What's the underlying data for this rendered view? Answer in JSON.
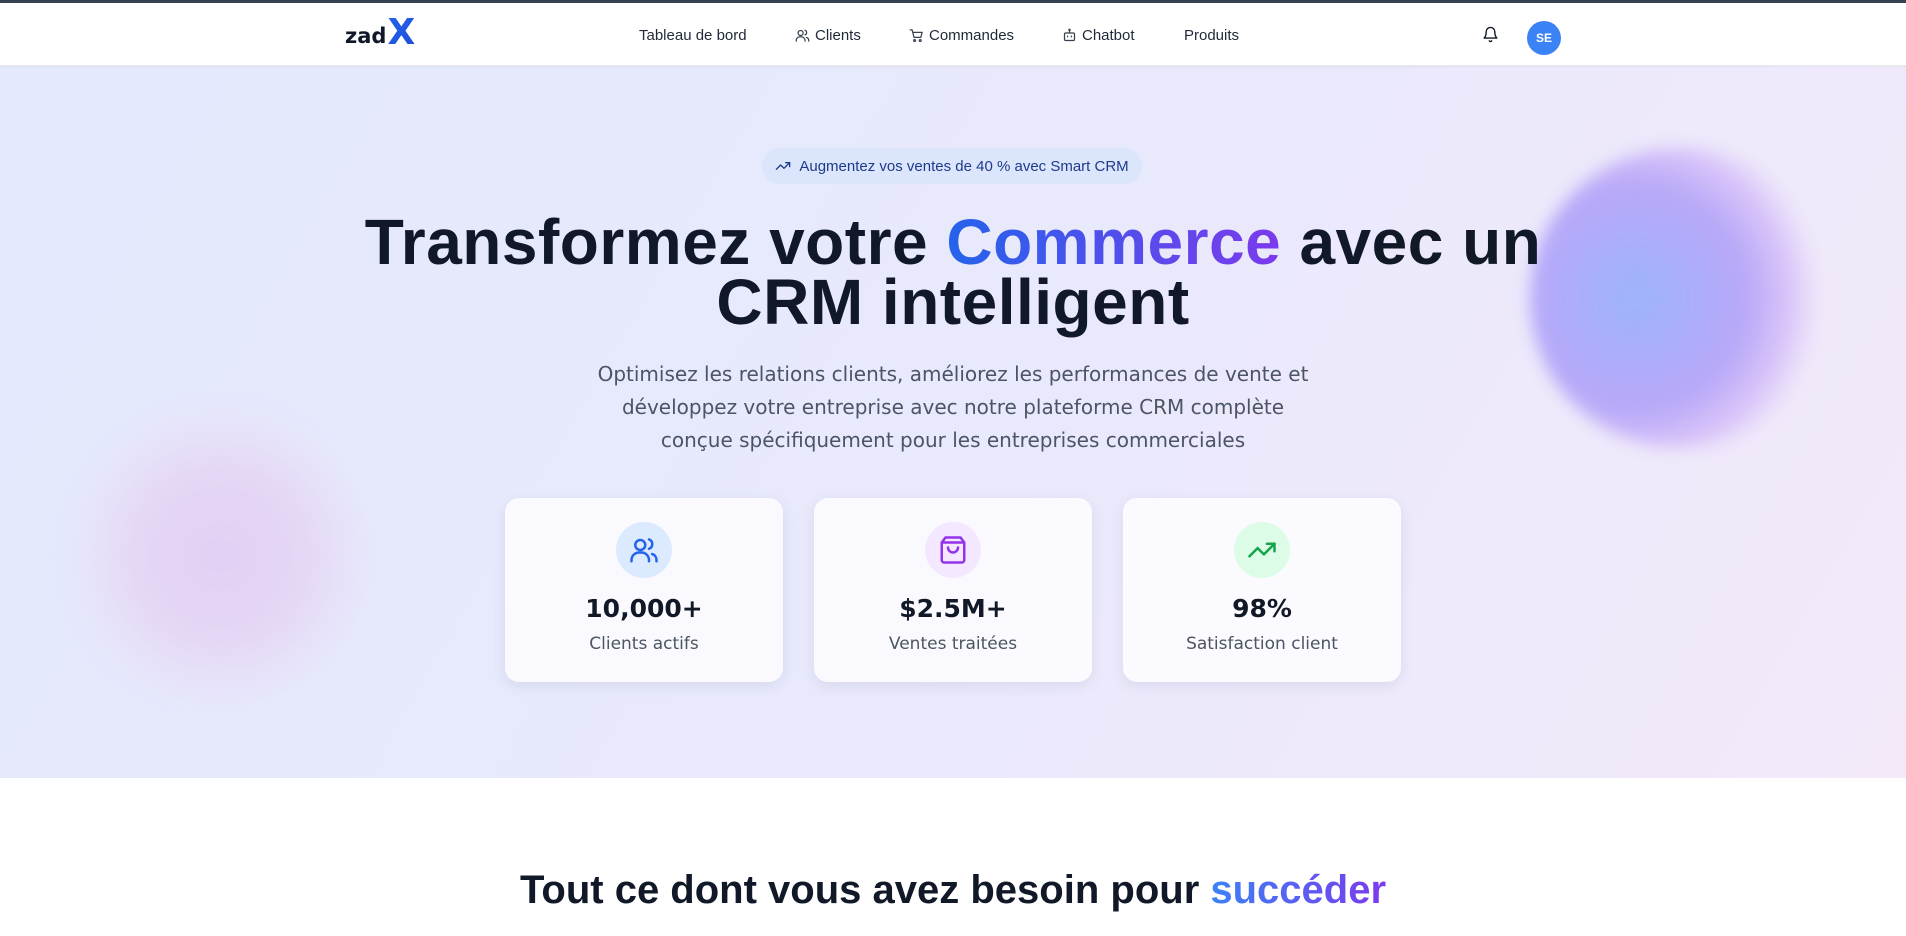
{
  "brand": {
    "text": "zad",
    "mark": "X"
  },
  "nav": {
    "items": [
      {
        "label": "Tableau de bord",
        "icon": ""
      },
      {
        "label": "Clients",
        "icon": "users-icon"
      },
      {
        "label": "Commandes",
        "icon": "cart-icon"
      },
      {
        "label": "Chatbot",
        "icon": "bot-icon"
      },
      {
        "label": "Produits",
        "icon": ""
      }
    ],
    "notifications_icon": "bell-icon",
    "avatar_initials": "SE"
  },
  "hero": {
    "badge": "Augmentez vos ventes de 40 % avec Smart CRM",
    "headline_start": "Transformez votre ",
    "headline_highlight": "Commerce",
    "headline_line1_end": " avec un",
    "headline_line2": "CRM intelligent",
    "subtitle": "Optimisez les relations clients, améliorez les performances de vente et développez votre entreprise avec notre plateforme CRM complète conçue spécifiquement pour les entreprises commerciales"
  },
  "stats": [
    {
      "value": "10,000+",
      "label": "Clients actifs",
      "icon": "users-icon",
      "color": "#2563eb",
      "bg": "#dbeafe"
    },
    {
      "value": "$2.5M+",
      "label": "Ventes traitées",
      "icon": "shopping-bag-icon",
      "color": "#9333ea",
      "bg": "#f3e8ff"
    },
    {
      "value": "98%",
      "label": "Satisfaction client",
      "icon": "trending-up-icon",
      "color": "#16a34a",
      "bg": "#dcfce7"
    }
  ],
  "features": {
    "title_start": "Tout ce dont vous avez besoin pour ",
    "title_highlight": "succéder"
  },
  "colors": {
    "primary": "#2563eb",
    "accent_purple": "#7c3aed",
    "text_dark": "#111827",
    "text_muted": "#4b5563"
  }
}
